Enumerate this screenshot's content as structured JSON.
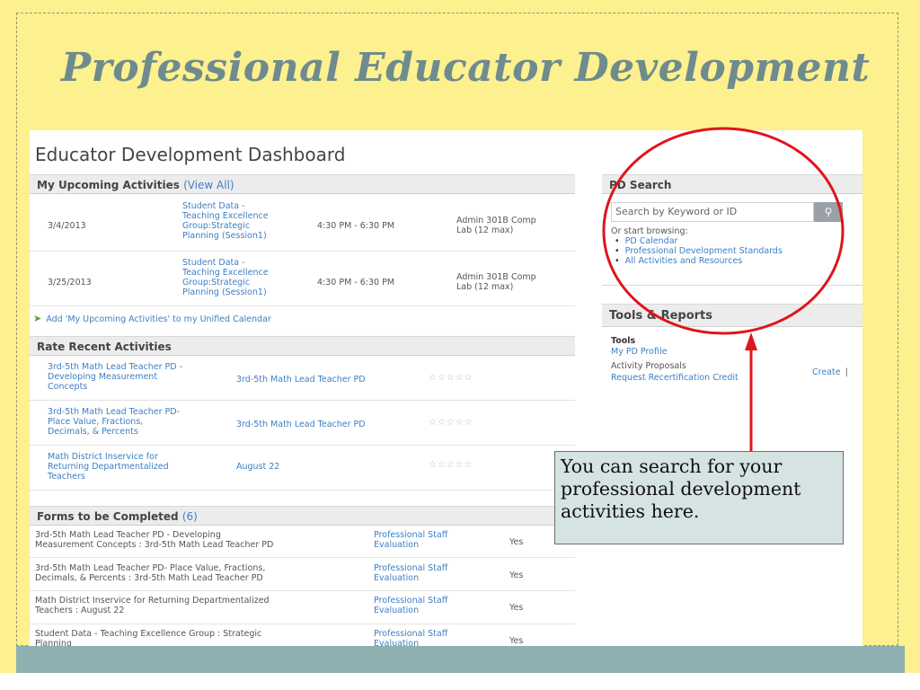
{
  "slide": {
    "title": "Professional Educator Development",
    "callout_text": "You can search for your professional development activities here."
  },
  "dashboard": {
    "title": "Educator Development Dashboard",
    "upcoming": {
      "header": "My Upcoming Activities",
      "view_all": "(View All)",
      "rows": [
        {
          "date": "3/4/2013",
          "title_lines": [
            "Student Data -",
            "Teaching Excellence",
            "Group:Strategic",
            "Planning (Session1)"
          ],
          "time": "4:30 PM - 6:30 PM",
          "location_lines": [
            "Admin 301B Comp",
            "Lab (12 max)"
          ]
        },
        {
          "date": "3/25/2013",
          "title_lines": [
            "Student Data -",
            "Teaching Excellence",
            "Group:Strategic",
            "Planning (Session1)"
          ],
          "time": "4:30 PM - 6:30 PM",
          "location_lines": [
            "Admin 301B Comp",
            "Lab (12 max)"
          ]
        }
      ],
      "add_calendar": "Add 'My Upcoming Activities' to my Unified Calendar"
    },
    "rate": {
      "header": "Rate Recent Activities",
      "stars": "☆☆☆☆☆",
      "rows": [
        {
          "title_lines": [
            "3rd-5th Math Lead Teacher PD -",
            "Developing Measurement",
            "Concepts"
          ],
          "group": "3rd-5th Math Lead Teacher PD"
        },
        {
          "title_lines": [
            "3rd-5th Math Lead Teacher PD-",
            "Place Value, Fractions,",
            "Decimals, & Percents"
          ],
          "group": "3rd-5th Math Lead Teacher PD"
        },
        {
          "title_lines": [
            "Math District Inservice for",
            "Returning Departmentalized",
            "Teachers"
          ],
          "group": "August 22"
        }
      ]
    },
    "forms": {
      "header": "Forms to be Completed",
      "count": "(6)",
      "rows": [
        {
          "desc_lines": [
            "3rd-5th Math Lead Teacher PD - Developing",
            "Measurement Concepts : 3rd-5th Math Lead Teacher PD"
          ],
          "form_lines": [
            "Professional Staff",
            "Evaluation"
          ],
          "required": "Yes"
        },
        {
          "desc_lines": [
            "3rd-5th Math Lead Teacher PD- Place Value, Fractions,",
            "Decimals, & Percents : 3rd-5th Math Lead Teacher PD"
          ],
          "form_lines": [
            "Professional Staff",
            "Evaluation"
          ],
          "required": "Yes"
        },
        {
          "desc_lines": [
            "Math District Inservice for Returning Departmentalized",
            "Teachers : August 22"
          ],
          "form_lines": [
            "Professional Staff",
            "Evaluation"
          ],
          "required": "Yes"
        },
        {
          "desc_lines": [
            "Student Data - Teaching Excellence Group : Strategic",
            "Planning"
          ],
          "form_lines": [
            "Professional Staff",
            "Evaluation"
          ],
          "required": "Yes"
        }
      ]
    },
    "pd_search": {
      "header": "PD Search",
      "placeholder": "Search by Keyword or ID",
      "browse_label": "Or start browsing:",
      "links": [
        "PD Calendar",
        "Professional Development Standards",
        "All Activities and Resources"
      ]
    },
    "tools": {
      "header": "Tools & Reports",
      "section_label": "Tools",
      "my_profile": "My PD Profile",
      "activity_proposals": "Activity Proposals",
      "create": "Create",
      "sep": "|",
      "recert": "Request Recertification Credit"
    }
  },
  "colors": {
    "slide_bg": "#fdf08e",
    "title": "#6e8b8e",
    "link": "#3d7fc2",
    "annotation": "#e0141b",
    "callout_bg": "#d5e3e2",
    "band": "#8fb0b0"
  }
}
